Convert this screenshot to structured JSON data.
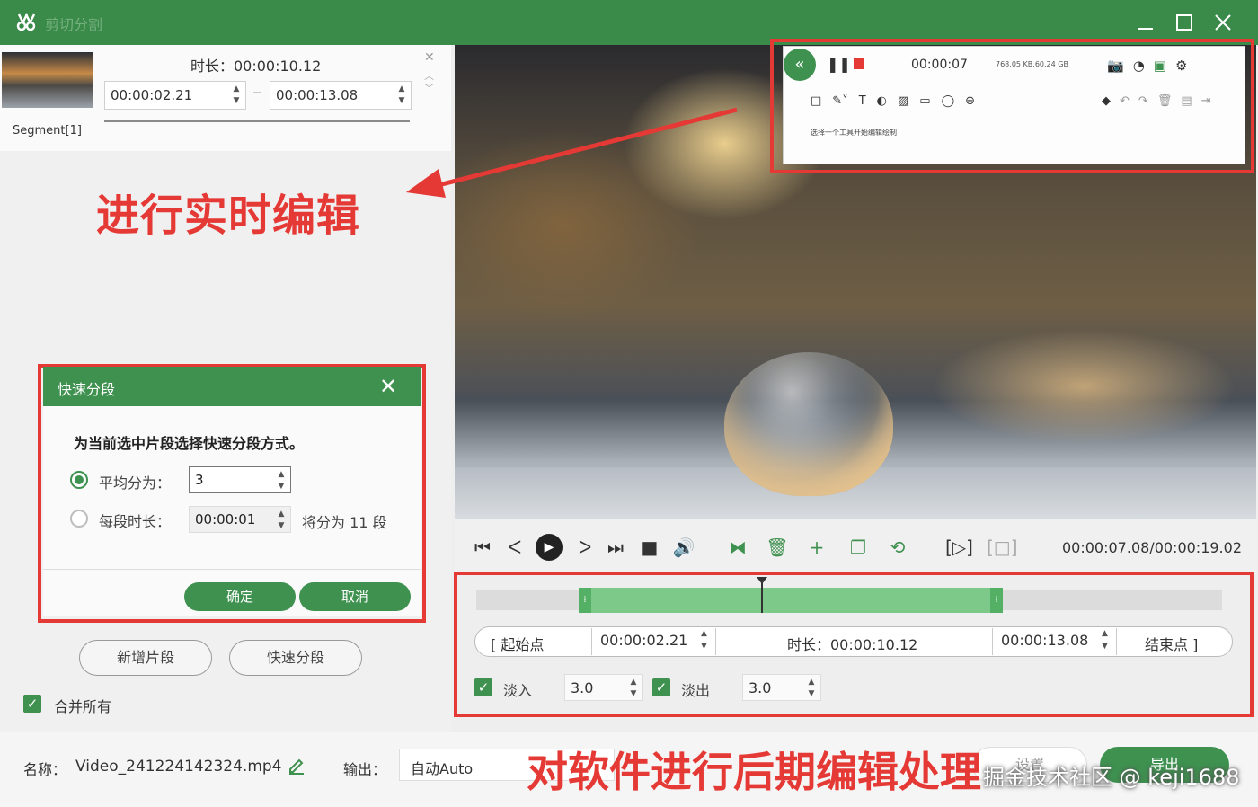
{
  "app": {
    "title": "剪切分割"
  },
  "segment": {
    "label": "Segment[1]",
    "duration_label": "时长：00:00:10.12",
    "start_time": "00:00:02.21",
    "end_time": "00:00:13.08"
  },
  "annotations": {
    "realtime_edit": "进行实时编辑",
    "post_edit": "对软件进行后期编辑处理",
    "watermark": "掘金技术社区 @ keji1688"
  },
  "dialog": {
    "title": "快速分段",
    "description": "为当前选中片段选择快速分段方式。",
    "option_average_label": "平均分为：",
    "option_average_value": "3",
    "option_duration_label": "每段时长：",
    "option_duration_value": "00:00:01",
    "split_note": "将分为 11 段",
    "ok_label": "确定",
    "cancel_label": "取消"
  },
  "left_actions": {
    "add_segment": "新增片段",
    "quick_split": "快速分段",
    "merge_all": "合并所有"
  },
  "bottom": {
    "name_label": "名称：",
    "name_value": "Video_241224142324.mp4",
    "output_label": "输出：",
    "output_value": "自动Auto",
    "ghost_button": "设置",
    "export_button": "导出"
  },
  "recorder": {
    "time": "00:00:07",
    "stats": "768.05 KB,60.24 GB",
    "hint": "选择一个工具开始编辑绘制"
  },
  "player": {
    "time_readout": "00:00:07.08/00:00:19.02",
    "playhead_fraction": 0.39,
    "selection_start_fraction": 0.137,
    "selection_end_fraction": 0.706
  },
  "edit_panel": {
    "start_point_label": "[ 起始点",
    "start_time": "00:00:02.21",
    "duration_label": "时长：00:00:10.12",
    "end_time": "00:00:13.08",
    "end_point_label": "结束点 ]",
    "fade_in_label": "淡入",
    "fade_in_value": "3.0",
    "fade_out_label": "淡出",
    "fade_out_value": "3.0"
  },
  "colors": {
    "brand_green": "#3f9150",
    "annotation_red": "#e53935",
    "selection_green": "#7cc98a"
  }
}
